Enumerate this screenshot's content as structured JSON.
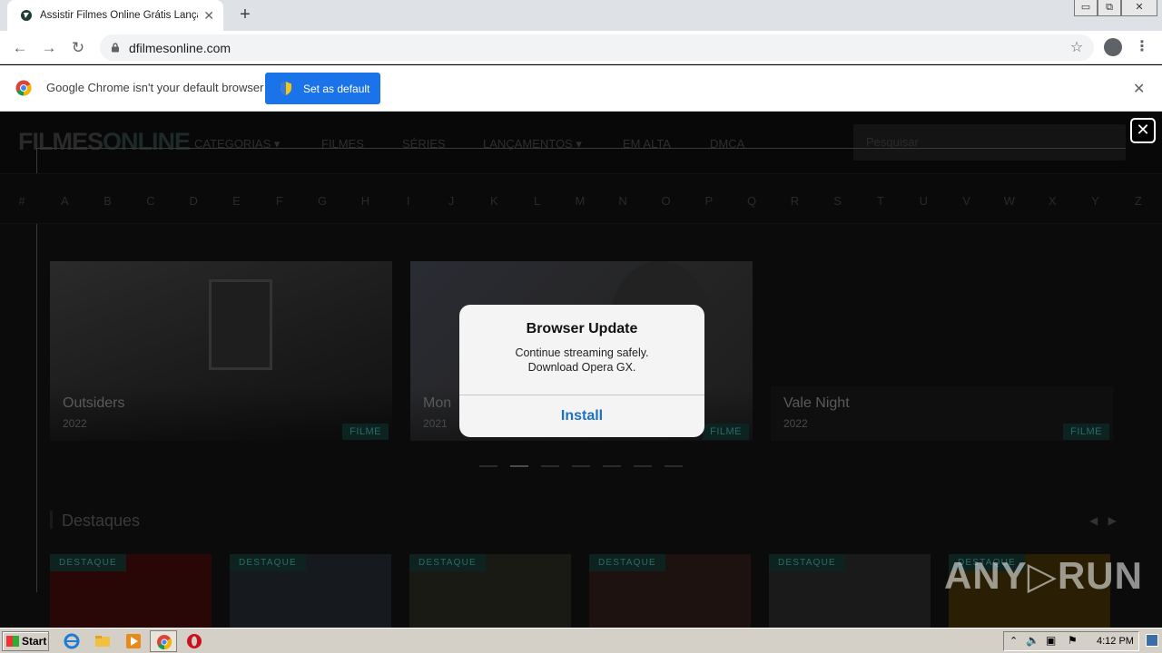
{
  "browser": {
    "tab_title": "Assistir Filmes Online Grátis Lançame",
    "tab_close": "✕",
    "new_tab": "+",
    "url": "dfilmesonline.com",
    "window_controls": [
      "▭",
      "⧉",
      "✕"
    ]
  },
  "infobar": {
    "message": "Google Chrome isn't your default browser",
    "button": "Set as default",
    "close": "✕"
  },
  "site": {
    "logo_a": "FILMES",
    "logo_b": "ONLINE",
    "nav": [
      "CATEGORIAS ▾",
      "FILMES",
      "SÉRIES",
      "LANÇAMENTOS ▾",
      "EM ALTA",
      "DMCA"
    ],
    "search_placeholder": "Pesquisar",
    "close_overlay": "✕",
    "alphabet": [
      "#",
      "A",
      "B",
      "C",
      "D",
      "E",
      "F",
      "G",
      "H",
      "I",
      "J",
      "K",
      "L",
      "M",
      "N",
      "O",
      "P",
      "Q",
      "R",
      "S",
      "T",
      "U",
      "V",
      "W",
      "X",
      "Y",
      "Z"
    ],
    "slides": [
      {
        "title": "Outsiders",
        "year": "2022",
        "badge": "FILME"
      },
      {
        "title": "Mon",
        "year": "2021",
        "badge": "FILME"
      },
      {
        "title": "Vale Night",
        "year": "2022",
        "badge": "FILME"
      }
    ],
    "section_title": "Destaques",
    "section_arrows": "◀ ▶",
    "cards": [
      "DESTAQUE",
      "DESTAQUE",
      "DESTAQUE",
      "DESTAQUE",
      "DESTAQUE",
      "DESTAQUE"
    ]
  },
  "modal": {
    "title": "Browser Update",
    "line1": "Continue streaming safely.",
    "line2": "Download Opera GX.",
    "button": "Install"
  },
  "watermark": "ANY▷RUN",
  "taskbar": {
    "start": "Start",
    "clock": "4:12 PM"
  },
  "colors": {
    "accent": "#1a73e8",
    "install": "#1f6fc2",
    "badge_bg": "#0d2321",
    "badge_text": "#2c6b66"
  }
}
